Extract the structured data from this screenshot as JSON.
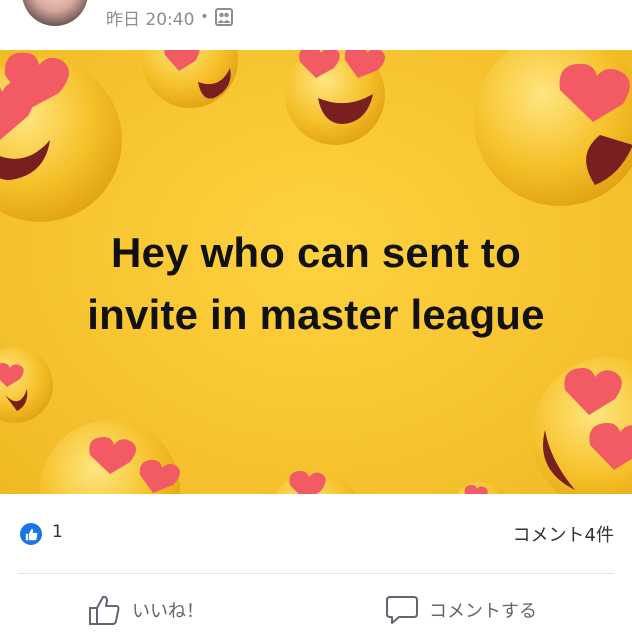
{
  "post": {
    "timestamp": "昨日 20:40",
    "separator": "•",
    "audience_icon": "group-icon",
    "image_caption": "Hey who can sent to invite in master league",
    "image_caption_line1": "Hey who can sent to",
    "image_caption_line2": "invite in master league"
  },
  "stats": {
    "like_count": "1",
    "comment_count": "コメント4件"
  },
  "actions": {
    "like_label": "いいね！",
    "comment_label": "コメントする"
  },
  "colors": {
    "accent": "#1b74e4",
    "image_background": "#f7c531",
    "muted_text": "#8a8d91"
  }
}
